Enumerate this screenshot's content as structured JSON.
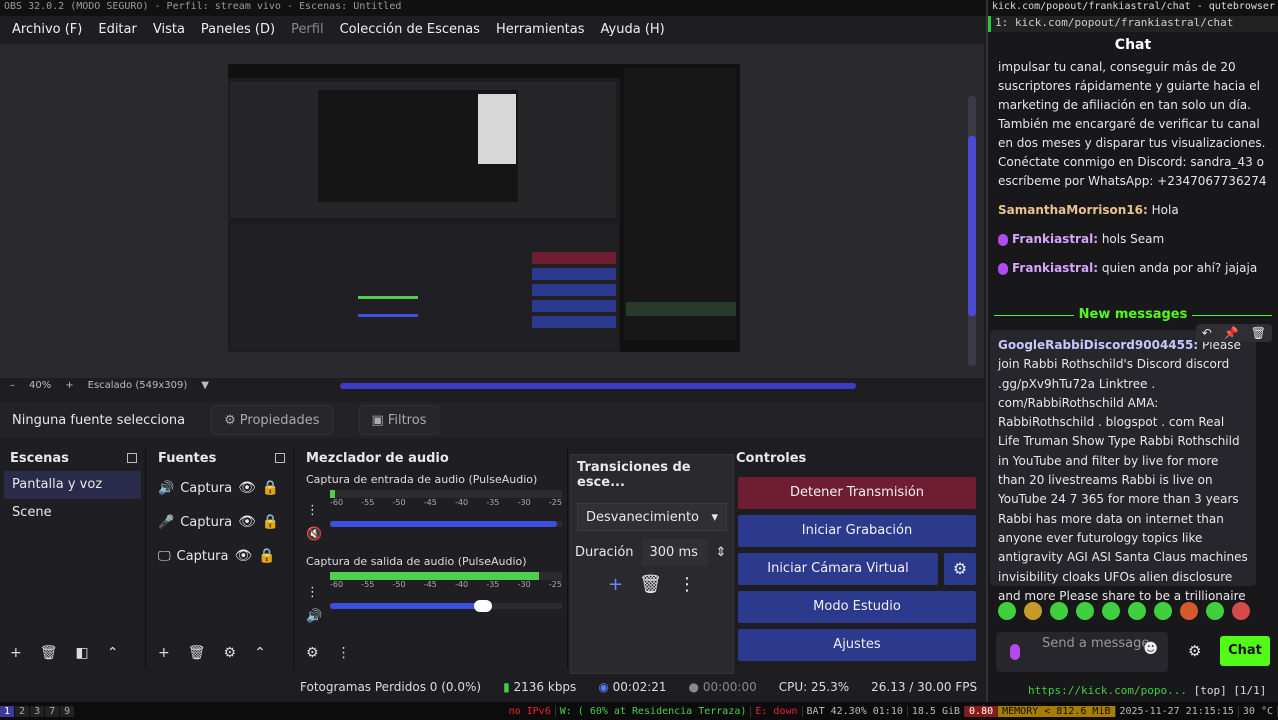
{
  "obs": {
    "title": "OBS 32.0.2 (MODO SEGURO) - Perfil: stream vivo - Escenas: Untitled",
    "menu": [
      "Archivo (F)",
      "Editar",
      "Vista",
      "Paneles (D)",
      "Perfil",
      "Colección de Escenas",
      "Herramientas",
      "Ayuda (H)"
    ],
    "zoom": {
      "minus": "–",
      "value": "40%",
      "plus": "+",
      "scale": "Escalado (549x309)"
    },
    "source_bar": {
      "none_selected": "Ninguna fuente selecciona",
      "properties": "Propiedades",
      "filters": "Filtros"
    },
    "scenes": {
      "title": "Escenas",
      "items": [
        "Pantalla y voz",
        "Scene"
      ]
    },
    "sources": {
      "title": "Fuentes",
      "items": [
        "Captura",
        "Captura",
        "Captura"
      ]
    },
    "mixer": {
      "title": "Mezclador de audio",
      "channels": [
        {
          "name": "Captura de entrada de audio (PulseAudio)",
          "level": 0.02,
          "volume": 0.98,
          "muted": true
        },
        {
          "name": "Captura de salida de audio (PulseAudio)",
          "level": 0.9,
          "volume": 0.66,
          "muted": false
        }
      ],
      "ticks": [
        "-60",
        "-55",
        "-50",
        "-45",
        "-40",
        "-35",
        "-30",
        "-25"
      ]
    },
    "transitions": {
      "title": "Transiciones de esce...",
      "selected": "Desvanecimiento",
      "duration_label": "Duración",
      "duration": "300 ms"
    },
    "controls": {
      "title": "Controles",
      "stop_stream": "Detener Transmisión",
      "start_recording": "Iniciar Grabación",
      "virtual_cam": "Iniciar Cámara Virtual",
      "studio_mode": "Modo Estudio",
      "settings": "Ajustes"
    },
    "status": {
      "dropped": "Fotogramas Perdidos 0 (0.0%)",
      "bitrate": "2136 kbps",
      "stream_time": "00:02:21",
      "rec_time": "00:00:00",
      "cpu": "CPU: 25.3%",
      "fps": "26.13 / 30.00 FPS"
    }
  },
  "browser": {
    "title": "kick.com/popout/frankiastral/chat - qutebrowser",
    "tab": "1: kick.com/popout/frankiastral/chat",
    "chat_title": "Chat",
    "messages": [
      {
        "user": "",
        "text": "impulsar tu canal, conseguir más de 20 suscriptores rápidamente y guiarte hacia el marketing de afiliación en tan solo un día. También me encargaré de verificar tu canal en dos meses y disparar tus visualizaciones. Conéctate conmigo en Discord: sandra_43 o escríbeme por WhatsApp: +2347067736274"
      },
      {
        "user": "SamanthaMorrison16:",
        "text": "Hola"
      },
      {
        "user": "Frankiastral:",
        "text": "hols Seam"
      },
      {
        "user": "Frankiastral:",
        "text": "quien anda por ahí? jajaja"
      }
    ],
    "new_messages": "New messages",
    "highlight": {
      "user": "GoogleRabbiDiscord9004455:",
      "text": "Please join Rabbi Rothschild's Discord discord .gg/pXv9hTu72a Linktree . com/RabbiRothschild AMA: RabbiRothschild . blogspot . com Real Life Truman Show Type Rabbi Rothschild in YouTube and filter by live for more than 20 livestreams Rabbi is live on YouTube 24 7 365 for more than 3 years Rabbi has more data on internet than anyone ever futurology topics like antigravity AGI ASI Santa Claus machines invisibility cloaks UFOs alien disclosure and more Please share to be a trillionaire"
    },
    "input_placeholder": "Send a message",
    "send": "Chat",
    "url_status": "https://kick.com/popo...",
    "pos": "[top] [1/1]"
  },
  "taskbar": {
    "workspaces": [
      "1",
      "2",
      "3",
      "7",
      "9"
    ],
    "net": "no IPv6",
    "wifi": "W: ( 60% at Residencia Terraza)",
    "eth": "E: down",
    "battery": "BAT 42.30% 01:10",
    "disk": "18.5 GiB",
    "load": "0.80",
    "memory": "MEMORY < 812.6 MiB",
    "datetime": "2025-11-27 21:15:15",
    "temp": "30 °C"
  }
}
